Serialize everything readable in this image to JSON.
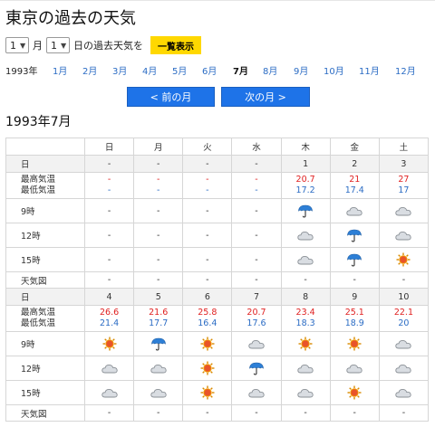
{
  "page": {
    "title": "東京の過去の天気",
    "subtitle": "1993年7月"
  },
  "controls": {
    "month_value": "1",
    "month_unit": "月",
    "day_value": "1",
    "day_suffix": "日の過去天気を",
    "show_button": "一覧表示"
  },
  "month_nav": {
    "year": "1993年",
    "months": [
      "1月",
      "2月",
      "3月",
      "4月",
      "5月",
      "6月",
      "7月",
      "8月",
      "9月",
      "10月",
      "11月",
      "12月"
    ],
    "current_month": "7月"
  },
  "nav_buttons": {
    "prev": "< 前の月",
    "next": "次の月 >"
  },
  "table": {
    "weekdays": [
      "日",
      "月",
      "火",
      "水",
      "木",
      "金",
      "土"
    ],
    "row_labels": {
      "date": "日",
      "hi": "最高気温",
      "lo": "最低気温",
      "t9": "9時",
      "t12": "12時",
      "t15": "15時",
      "map": "天気図"
    },
    "weeks": [
      {
        "dates": [
          "-",
          "-",
          "-",
          "-",
          "1",
          "2",
          "3"
        ],
        "hi": [
          "-",
          "-",
          "-",
          "-",
          "20.7",
          "21",
          "27"
        ],
        "lo": [
          "-",
          "-",
          "-",
          "-",
          "17.2",
          "17.4",
          "17"
        ],
        "t9": [
          "-",
          "-",
          "-",
          "-",
          "umbrella-icon",
          "cloud-icon",
          "cloud-icon"
        ],
        "t12": [
          "-",
          "-",
          "-",
          "-",
          "cloud-icon",
          "umbrella-icon",
          "cloud-icon"
        ],
        "t15": [
          "-",
          "-",
          "-",
          "-",
          "cloud-icon",
          "umbrella-icon",
          "sun-icon"
        ],
        "map": [
          "-",
          "-",
          "-",
          "-",
          "-",
          "-",
          "-"
        ]
      },
      {
        "dates": [
          "4",
          "5",
          "6",
          "7",
          "8",
          "9",
          "10"
        ],
        "hi": [
          "26.6",
          "21.6",
          "25.8",
          "20.7",
          "23.4",
          "25.1",
          "22.1"
        ],
        "lo": [
          "21.4",
          "17.7",
          "16.4",
          "17.6",
          "18.3",
          "18.9",
          "20"
        ],
        "t9": [
          "sun-icon",
          "umbrella-icon",
          "sun-icon",
          "cloud-icon",
          "sun-icon",
          "sun-icon",
          "cloud-icon"
        ],
        "t12": [
          "cloud-icon",
          "cloud-icon",
          "sun-icon",
          "umbrella-icon",
          "cloud-icon",
          "cloud-icon",
          "cloud-icon"
        ],
        "t15": [
          "cloud-icon",
          "cloud-icon",
          "sun-icon",
          "cloud-icon",
          "cloud-icon",
          "sun-icon",
          "cloud-icon"
        ],
        "map": [
          "-",
          "-",
          "-",
          "-",
          "-",
          "-",
          "-"
        ]
      }
    ]
  },
  "colors": {
    "accent": "#1e73e8",
    "sunday": "#e02020",
    "saturday": "#2b6cc4",
    "show_button": "#ffd800"
  }
}
